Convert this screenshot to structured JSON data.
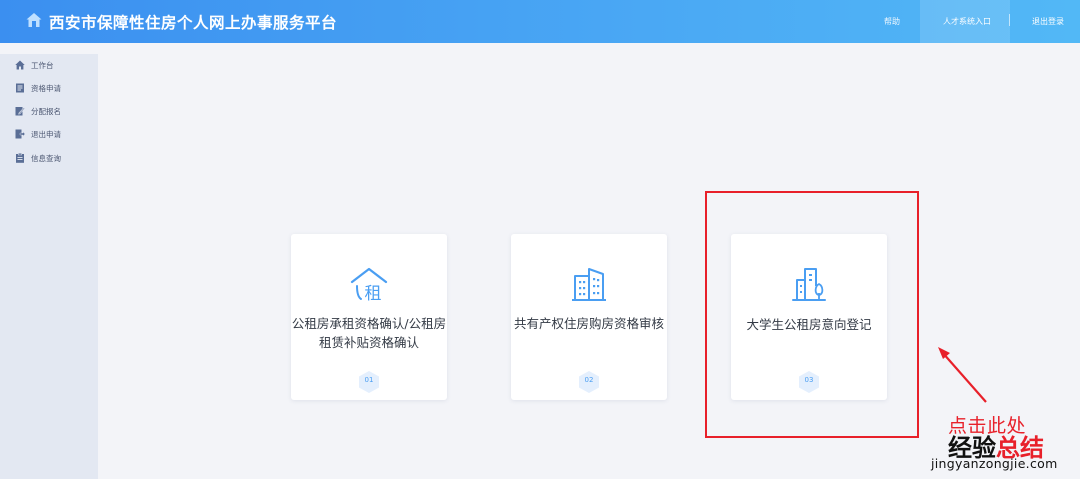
{
  "header": {
    "title": "西安市保障性住房个人网上办事服务平台",
    "logo_icon": "house-icon",
    "links": {
      "help": "帮助",
      "talent": "人才系统入口",
      "logout": "退出登录"
    }
  },
  "sidebar": {
    "items": [
      {
        "label": "工作台",
        "icon": "home-icon"
      },
      {
        "label": "资格申请",
        "icon": "document-icon"
      },
      {
        "label": "分配报名",
        "icon": "edit-icon"
      },
      {
        "label": "退出申请",
        "icon": "exit-icon"
      },
      {
        "label": "信息查询",
        "icon": "clipboard-icon"
      }
    ]
  },
  "cards": [
    {
      "line1": "公租房承租资格确认/公租房",
      "line2": "租赁补贴资格确认",
      "badge": "01",
      "icon": "rent-house-icon"
    },
    {
      "line1": "共有产权住房购房资格审核",
      "line2": "",
      "badge": "02",
      "icon": "building-icon"
    },
    {
      "line1": "大学生公租房意向登记",
      "line2": "",
      "badge": "03",
      "icon": "dorm-tree-icon"
    }
  ],
  "annotation": {
    "click_hint": "点击此处"
  },
  "watermark": {
    "cn_part1": "经验",
    "cn_part2": "总结",
    "en": "jingyanzongjie.com"
  },
  "colors": {
    "accent": "#3b8ff0",
    "icon_blue": "#4a9ef2",
    "highlight_red": "#e8202a"
  }
}
